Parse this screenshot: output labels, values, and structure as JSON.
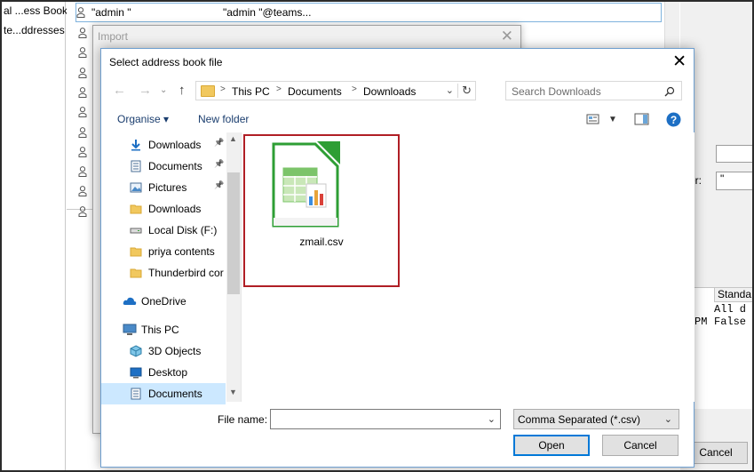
{
  "background": {
    "left_panel": [
      "al ...ess Book",
      "te...ddresses"
    ],
    "contacts": [
      {
        "name": "\"admin \"",
        "email": "\"admin \"@teams..."
      }
    ],
    "right_panel": {
      "label_er": "er:",
      "select_value": "\"",
      "table_header": "Standa",
      "table_cells": [
        "All d",
        "PM",
        "False"
      ],
      "cancel": "Cancel"
    }
  },
  "import_dialog": {
    "title": "Import",
    "close_glyph": "✕"
  },
  "dialog": {
    "title": "Select address book file",
    "close_glyph": "✕",
    "address_bar": {
      "segments": [
        "This PC",
        "Documents",
        "Downloads"
      ]
    },
    "search": {
      "placeholder": "Search Downloads"
    },
    "toolbar": {
      "organise": "Organise ▾",
      "new_folder": "New folder"
    },
    "nav_items": [
      {
        "label": "Downloads",
        "icon": "download-arrow-icon",
        "pinned": true
      },
      {
        "label": "Documents",
        "icon": "document-icon",
        "pinned": true
      },
      {
        "label": "Pictures",
        "icon": "pictures-icon",
        "pinned": true
      },
      {
        "label": "Downloads",
        "icon": "folder-icon",
        "pinned": false
      },
      {
        "label": "Local Disk (F:)",
        "icon": "drive-icon",
        "pinned": false
      },
      {
        "label": "priya contents",
        "icon": "folder-icon",
        "pinned": false
      },
      {
        "label": "Thunderbird cor",
        "icon": "folder-icon",
        "pinned": false
      },
      {
        "label": "OneDrive",
        "icon": "cloud-icon",
        "pinned": false
      },
      {
        "label": "This PC",
        "icon": "computer-icon",
        "pinned": false
      },
      {
        "label": "3D Objects",
        "icon": "cube-icon",
        "pinned": false
      },
      {
        "label": "Desktop",
        "icon": "desktop-icon",
        "pinned": false
      },
      {
        "label": "Documents",
        "icon": "document-icon",
        "pinned": false
      }
    ],
    "files": [
      {
        "name": "zmail.csv",
        "icon": "spreadsheet-file-icon"
      }
    ],
    "file_name_label": "File name:",
    "file_name_value": "",
    "file_type": "Comma Separated (*.csv)",
    "open_label": "Open",
    "cancel_label": "Cancel",
    "colors": {
      "accent": "#0078d7",
      "selection": "#cce8ff",
      "highlight_border": "#b01e25",
      "folder": "#f1c85e",
      "spreadsheet_green": "#2e9e34"
    }
  }
}
